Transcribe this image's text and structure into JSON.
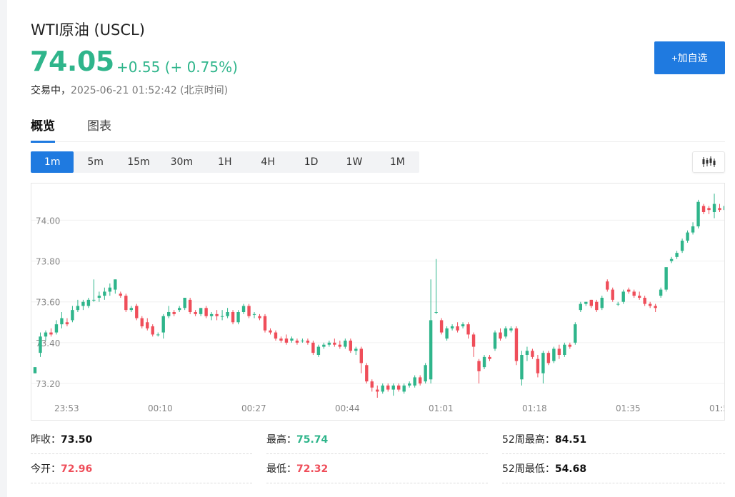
{
  "header": {
    "title": "WTI原油 (USCL)",
    "price": "74.05",
    "change": "+0.55 (+ 0.75%)",
    "status": "交易中，",
    "timestamp": "2025-06-21 01:52:42 (北京时间)",
    "add_label": "+加自选"
  },
  "tabs": [
    {
      "label": "概览",
      "active": true
    },
    {
      "label": "图表",
      "active": false
    }
  ],
  "intervals": [
    {
      "label": "1m",
      "active": true
    },
    {
      "label": "5m",
      "active": false
    },
    {
      "label": "15m",
      "active": false
    },
    {
      "label": "30m",
      "active": false
    },
    {
      "label": "1H",
      "active": false
    },
    {
      "label": "4H",
      "active": false
    },
    {
      "label": "1D",
      "active": false
    },
    {
      "label": "1W",
      "active": false
    },
    {
      "label": "1M",
      "active": false
    }
  ],
  "chart_type_icon": "candlestick-icon",
  "colors": {
    "up": "#2fb58b",
    "down": "#ef4e5a",
    "accent": "#1f7ae0"
  },
  "chart_data": {
    "type": "candlestick",
    "ylim": [
      73.13,
      74.18
    ],
    "y_ticks": [
      "74.00",
      "73.80",
      "73.60",
      "73.40",
      "73.20"
    ],
    "x_ticks": [
      "23:53",
      "00:10",
      "00:27",
      "00:44",
      "01:01",
      "01:18",
      "01:35",
      "01:5"
    ],
    "grid": true,
    "candles": [
      [
        73.25,
        73.28,
        73.25,
        73.28
      ],
      [
        73.35,
        73.45,
        73.33,
        73.43
      ],
      [
        73.43,
        73.46,
        73.41,
        73.45
      ],
      [
        73.45,
        73.47,
        73.43,
        73.44
      ],
      [
        73.45,
        73.51,
        73.44,
        73.49
      ],
      [
        73.49,
        73.55,
        73.47,
        73.52
      ],
      [
        73.5,
        73.52,
        73.48,
        73.49
      ],
      [
        73.51,
        73.58,
        73.5,
        73.56
      ],
      [
        73.56,
        73.61,
        73.55,
        73.58
      ],
      [
        73.58,
        73.61,
        73.56,
        73.6
      ],
      [
        73.58,
        73.62,
        73.57,
        73.61
      ],
      [
        73.61,
        73.71,
        73.6,
        73.61
      ],
      [
        73.62,
        73.65,
        73.6,
        73.63
      ],
      [
        73.63,
        73.67,
        73.61,
        73.65
      ],
      [
        73.65,
        73.69,
        73.63,
        73.67
      ],
      [
        73.66,
        73.71,
        73.64,
        73.71
      ],
      [
        73.64,
        73.65,
        73.62,
        73.63
      ],
      [
        73.63,
        73.64,
        73.55,
        73.56
      ],
      [
        73.56,
        73.58,
        73.55,
        73.57
      ],
      [
        73.58,
        73.59,
        73.51,
        73.52
      ],
      [
        73.52,
        73.53,
        73.47,
        73.48
      ],
      [
        73.5,
        73.52,
        73.46,
        73.47
      ],
      [
        73.48,
        73.49,
        73.43,
        73.44
      ],
      [
        73.44,
        73.45,
        73.43,
        73.44
      ],
      [
        73.45,
        73.54,
        73.42,
        73.53
      ],
      [
        73.53,
        73.58,
        73.52,
        73.55
      ],
      [
        73.55,
        73.56,
        73.53,
        73.54
      ],
      [
        73.56,
        73.58,
        73.55,
        73.57
      ],
      [
        73.57,
        73.61,
        73.56,
        73.62
      ],
      [
        73.61,
        73.62,
        73.54,
        73.55
      ],
      [
        73.55,
        73.56,
        73.53,
        73.54
      ],
      [
        73.54,
        73.57,
        73.53,
        73.57
      ],
      [
        73.57,
        73.58,
        73.52,
        73.53
      ],
      [
        73.53,
        73.55,
        73.51,
        73.54
      ],
      [
        73.54,
        73.56,
        73.51,
        73.53
      ],
      [
        73.53,
        73.56,
        73.51,
        73.53
      ],
      [
        73.53,
        73.57,
        73.52,
        73.55
      ],
      [
        73.55,
        73.56,
        73.49,
        73.5
      ],
      [
        73.5,
        73.56,
        73.49,
        73.55
      ],
      [
        73.55,
        73.59,
        73.54,
        73.58
      ],
      [
        73.58,
        73.59,
        73.52,
        73.53
      ],
      [
        73.54,
        73.55,
        73.52,
        73.54
      ],
      [
        73.53,
        73.54,
        73.51,
        73.52
      ],
      [
        73.53,
        73.54,
        73.45,
        73.46
      ],
      [
        73.46,
        73.47,
        73.44,
        73.45
      ],
      [
        73.45,
        73.46,
        73.41,
        73.42
      ],
      [
        73.42,
        73.43,
        73.4,
        73.41
      ],
      [
        73.42,
        73.44,
        73.39,
        73.4
      ],
      [
        73.41,
        73.43,
        73.4,
        73.42
      ],
      [
        73.41,
        73.42,
        73.39,
        73.4
      ],
      [
        73.41,
        73.42,
        73.4,
        73.41
      ],
      [
        73.41,
        73.42,
        73.39,
        73.4
      ],
      [
        73.4,
        73.41,
        73.34,
        73.35
      ],
      [
        73.34,
        73.39,
        73.33,
        73.38
      ],
      [
        73.38,
        73.4,
        73.37,
        73.39
      ],
      [
        73.39,
        73.41,
        73.38,
        73.4
      ],
      [
        73.4,
        73.42,
        73.38,
        73.39
      ],
      [
        73.39,
        73.41,
        73.37,
        73.38
      ],
      [
        73.38,
        73.42,
        73.37,
        73.41
      ],
      [
        73.41,
        73.42,
        73.35,
        73.36
      ],
      [
        73.36,
        73.38,
        73.34,
        73.37
      ],
      [
        73.37,
        73.38,
        73.25,
        73.3
      ],
      [
        73.29,
        73.3,
        73.2,
        73.21
      ],
      [
        73.21,
        73.22,
        73.16,
        73.18
      ],
      [
        73.17,
        73.19,
        73.13,
        73.16
      ],
      [
        73.16,
        73.2,
        73.15,
        73.19
      ],
      [
        73.19,
        73.2,
        73.16,
        73.17
      ],
      [
        73.17,
        73.2,
        73.14,
        73.19
      ],
      [
        73.19,
        73.2,
        73.16,
        73.17
      ],
      [
        73.16,
        73.2,
        73.15,
        73.19
      ],
      [
        73.19,
        73.21,
        73.18,
        73.2
      ],
      [
        73.19,
        73.24,
        73.18,
        73.23
      ],
      [
        73.23,
        73.24,
        73.19,
        73.2
      ],
      [
        73.21,
        73.3,
        73.2,
        73.29
      ],
      [
        73.22,
        73.71,
        73.2,
        73.51
      ],
      [
        73.55,
        73.81,
        73.54,
        73.55
      ],
      [
        73.51,
        73.52,
        73.44,
        73.45
      ],
      [
        73.42,
        73.48,
        73.41,
        73.47
      ],
      [
        73.47,
        73.49,
        73.46,
        73.48
      ],
      [
        73.48,
        73.5,
        73.45,
        73.46
      ],
      [
        73.48,
        73.5,
        73.47,
        73.49
      ],
      [
        73.49,
        73.5,
        73.42,
        73.44
      ],
      [
        73.44,
        73.45,
        73.33,
        73.38
      ],
      [
        73.31,
        73.32,
        73.2,
        73.26
      ],
      [
        73.28,
        73.34,
        73.27,
        73.33
      ],
      [
        73.33,
        73.34,
        73.31,
        73.32
      ],
      [
        73.37,
        73.46,
        73.36,
        73.45
      ],
      [
        73.45,
        73.47,
        73.41,
        73.42
      ],
      [
        73.43,
        73.48,
        73.42,
        73.47
      ],
      [
        73.46,
        73.48,
        73.45,
        73.47
      ],
      [
        73.47,
        73.48,
        73.29,
        73.31
      ],
      [
        73.22,
        73.36,
        73.19,
        73.34
      ],
      [
        73.34,
        73.38,
        73.31,
        73.36
      ],
      [
        73.36,
        73.37,
        73.32,
        73.33
      ],
      [
        73.32,
        73.34,
        73.23,
        73.25
      ],
      [
        73.25,
        73.36,
        73.2,
        73.35
      ],
      [
        73.35,
        73.36,
        73.29,
        73.3
      ],
      [
        73.31,
        73.38,
        73.3,
        73.37
      ],
      [
        73.37,
        73.39,
        73.32,
        73.34
      ],
      [
        73.34,
        73.4,
        73.33,
        73.39
      ],
      [
        73.39,
        73.4,
        73.37,
        73.38
      ],
      [
        73.4,
        73.5,
        73.39,
        73.49
      ],
      [
        73.56,
        73.6,
        73.55,
        73.59
      ],
      [
        73.59,
        73.6,
        73.58,
        73.6
      ],
      [
        73.61,
        73.61,
        73.57,
        73.58
      ],
      [
        73.6,
        73.61,
        73.55,
        73.56
      ],
      [
        73.57,
        73.63,
        73.56,
        73.62
      ],
      [
        73.7,
        73.71,
        73.65,
        73.66
      ],
      [
        73.66,
        73.67,
        73.6,
        73.61
      ],
      [
        73.59,
        73.6,
        73.58,
        73.59
      ],
      [
        73.6,
        73.66,
        73.59,
        73.65
      ],
      [
        73.66,
        73.67,
        73.64,
        73.65
      ],
      [
        73.65,
        73.66,
        73.62,
        73.63
      ],
      [
        73.63,
        73.65,
        73.61,
        73.62
      ],
      [
        73.62,
        73.63,
        73.58,
        73.59
      ],
      [
        73.59,
        73.6,
        73.57,
        73.58
      ],
      [
        73.58,
        73.59,
        73.55,
        73.57
      ],
      [
        73.63,
        73.67,
        73.62,
        73.66
      ],
      [
        73.66,
        73.76,
        73.65,
        73.77
      ],
      [
        73.8,
        73.82,
        73.79,
        73.81
      ],
      [
        73.82,
        73.85,
        73.81,
        73.84
      ],
      [
        73.85,
        73.91,
        73.84,
        73.9
      ],
      [
        73.9,
        73.95,
        73.89,
        73.94
      ],
      [
        73.94,
        73.99,
        73.93,
        73.97
      ],
      [
        73.97,
        74.1,
        73.96,
        74.09
      ],
      [
        74.07,
        74.08,
        74.03,
        74.04
      ],
      [
        74.06,
        74.07,
        74.03,
        74.05
      ],
      [
        74.04,
        74.13,
        74.01,
        74.08
      ],
      [
        74.06,
        74.08,
        74.04,
        74.05
      ],
      [
        74.05,
        74.08,
        74.04,
        74.07
      ]
    ]
  },
  "stats": [
    [
      {
        "label": "昨收：",
        "value": "73.50",
        "tone": "neutral"
      },
      {
        "label": "最高：",
        "value": "75.74",
        "tone": "up"
      },
      {
        "label": "52周最高：",
        "value": "84.51",
        "tone": "neutral"
      }
    ],
    [
      {
        "label": "今开：",
        "value": "72.96",
        "tone": "down"
      },
      {
        "label": "最低：",
        "value": "72.32",
        "tone": "down"
      },
      {
        "label": "52周最低：",
        "value": "54.68",
        "tone": "neutral"
      }
    ]
  ]
}
